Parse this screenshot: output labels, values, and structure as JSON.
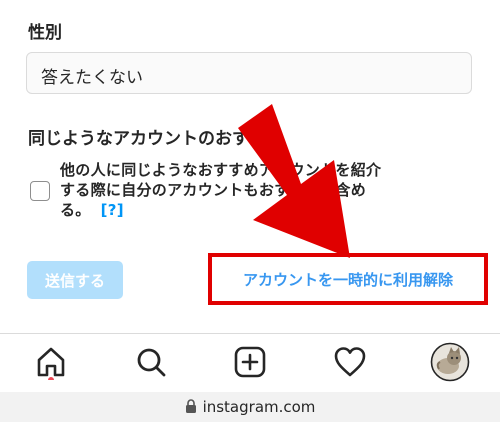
{
  "form": {
    "gender_label": "性別",
    "gender_value": "答えたくない",
    "similar_title": "同じようなアカウントのおすすめ",
    "similar_desc": "他の人に同じようなおすすめアカウントを紹介する際に自分のアカウントもおすすめに含める。",
    "help_link": "[?]",
    "submit_label": "送信する",
    "disable_link": "アカウントを一時的に利用解除"
  },
  "nav": {
    "items": [
      "home-icon",
      "search-icon",
      "new-post-icon",
      "activity-heart-icon",
      "profile-avatar"
    ]
  },
  "browser": {
    "url": "instagram.com"
  },
  "colors": {
    "accent": "#0095f6",
    "annotation_red": "#e00000",
    "submit_disabled": "#b2dffc",
    "notification_dot": "#ed4956"
  }
}
